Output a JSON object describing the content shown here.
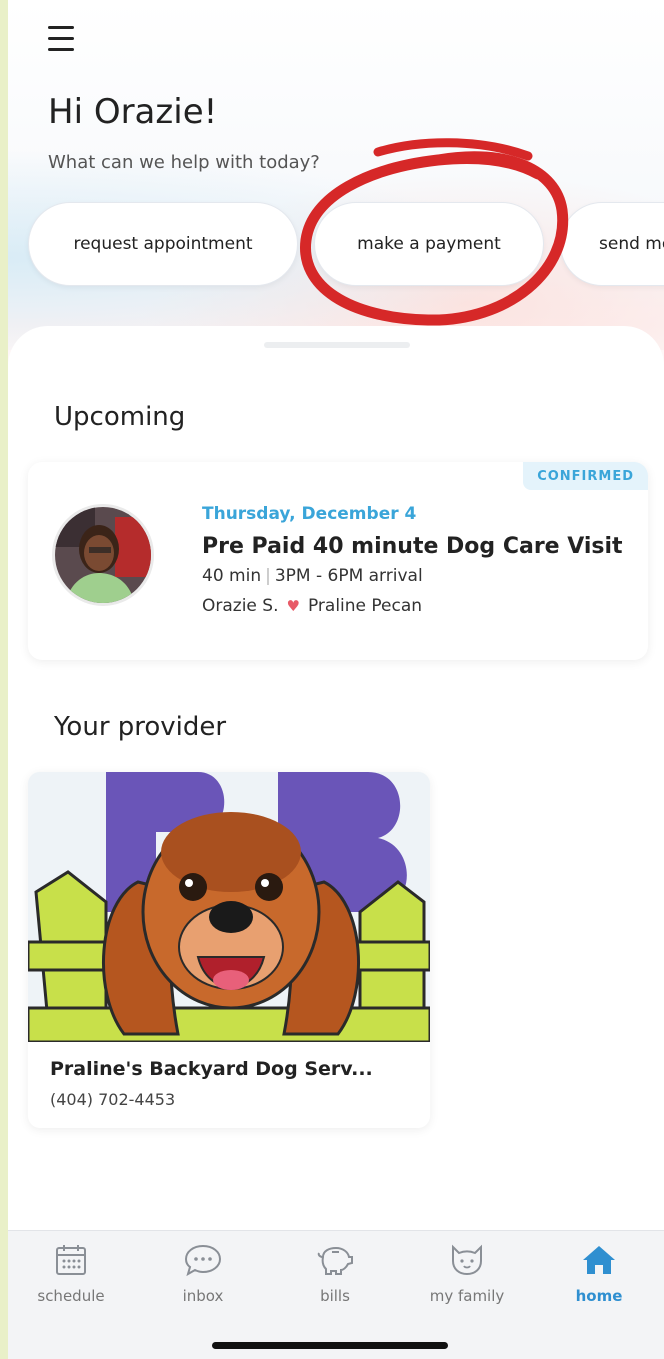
{
  "header": {
    "menu_icon": "hamburger-menu-icon",
    "greeting": "Hi Orazie!",
    "subtitle": "What can we help with today?"
  },
  "quick_actions": [
    {
      "label": "request appointment"
    },
    {
      "label": "make a payment"
    },
    {
      "label": "send me"
    }
  ],
  "upcoming": {
    "title": "Upcoming",
    "appointment": {
      "status": "CONFIRMED",
      "date": "Thursday, December 4",
      "service": "Pre Paid 40 minute Dog Care Visit",
      "duration": "40 min",
      "arrival": "3PM - 6PM arrival",
      "client": "Orazie S.",
      "pet": "Praline Pecan"
    }
  },
  "provider": {
    "title": "Your provider",
    "name": "Praline's Backyard Dog Serv...",
    "phone": "(404) 702-4453",
    "logo_text": "PB"
  },
  "tabs": [
    {
      "label": "schedule",
      "icon": "calendar-icon"
    },
    {
      "label": "inbox",
      "icon": "chat-bubble-icon"
    },
    {
      "label": "bills",
      "icon": "piggy-bank-icon"
    },
    {
      "label": "my family",
      "icon": "cat-face-icon"
    },
    {
      "label": "home",
      "icon": "house-icon",
      "active": true
    }
  ],
  "colors": {
    "accent": "#2f8fd0",
    "confirmed": "#3aa5d9",
    "annotation": "#d62828",
    "heart": "#e85a67"
  }
}
